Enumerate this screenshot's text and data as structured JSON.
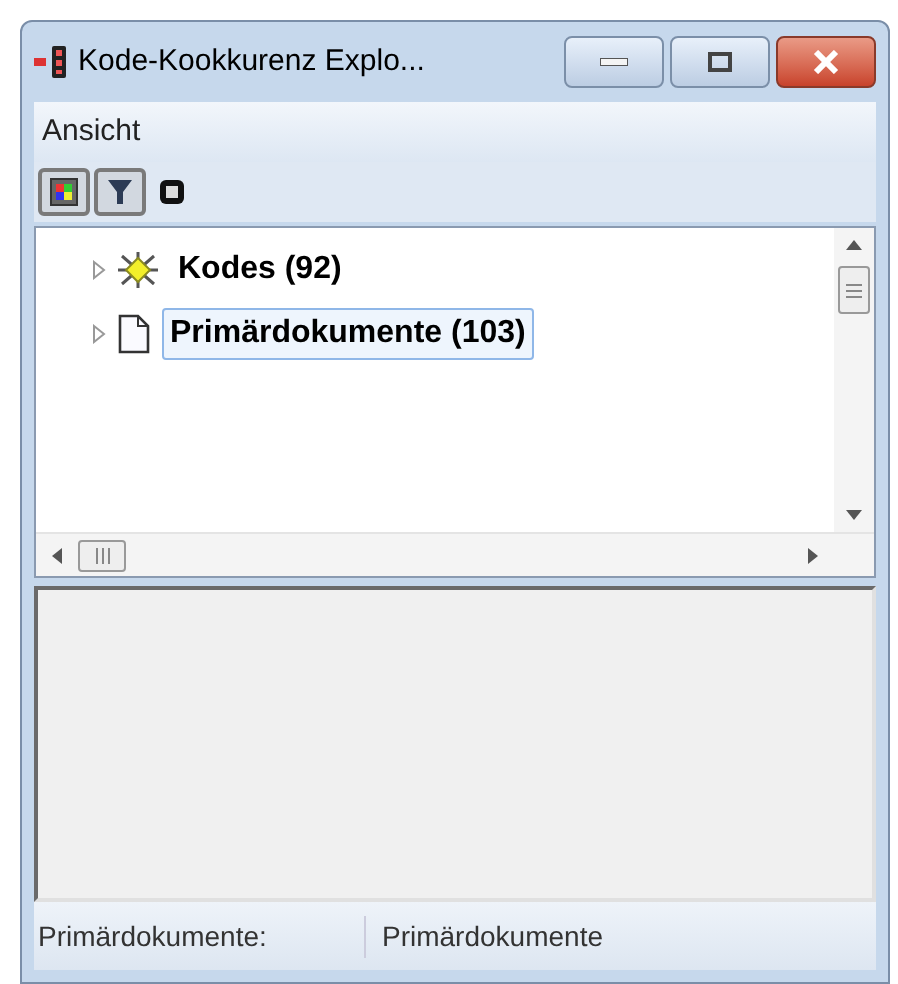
{
  "window": {
    "title": "Kode-Kookkurenz Explo..."
  },
  "menu": [
    "Ansicht"
  ],
  "toolbar": [
    {
      "kind": "colors",
      "selected": true
    },
    {
      "kind": "filter",
      "selected": true
    },
    {
      "kind": "frame",
      "selected": false
    }
  ],
  "tree": [
    {
      "kind": "codes",
      "label": "Kodes (92)",
      "selected": false
    },
    {
      "kind": "documents",
      "label": "Primärdokumente (103)",
      "selected": true
    }
  ],
  "status_bar": [
    "Primärdokumente:",
    "Primärdokumente"
  ]
}
